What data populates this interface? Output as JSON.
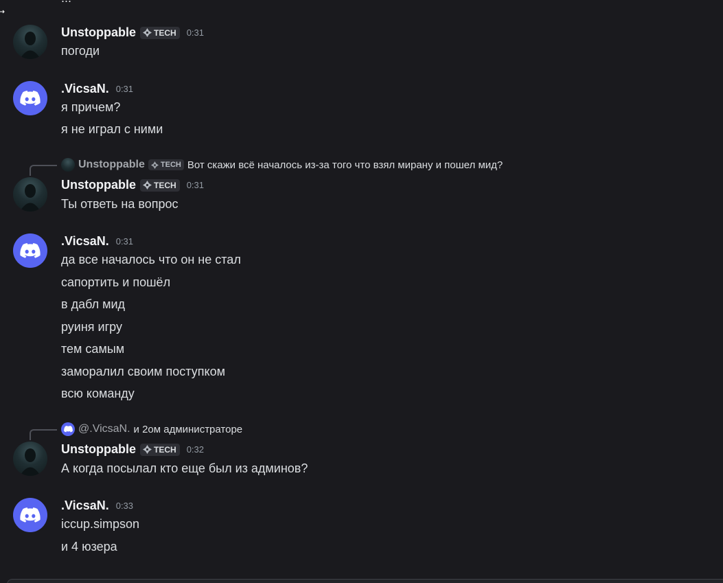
{
  "top_cutoff_text": "...",
  "messages": [
    {
      "user": "Unstoppable",
      "tag": "TECH",
      "time": "0:31",
      "lines": [
        "погоди"
      ]
    },
    {
      "user": ".VicsaN.",
      "time": "0:31",
      "lines": [
        "я причем?",
        "я не играл с ними"
      ]
    },
    {
      "reply": {
        "user": "Unstoppable",
        "tag": "TECH",
        "text": "Вот скажи всё началось из-за того что взял мирану и пошел мид?"
      },
      "user": "Unstoppable",
      "tag": "TECH",
      "time": "0:31",
      "lines": [
        "Ты ответь на вопрос"
      ]
    },
    {
      "user": ".VicsaN.",
      "time": "0:31",
      "lines": [
        "да все началось что он не стал",
        "сапортить и пошёл",
        "в дабл мид",
        "руиня игру",
        "тем самым",
        "заморалил своим поступком",
        "всю команду"
      ]
    },
    {
      "reply": {
        "user": "@.VicsaN.",
        "text": "и 2ом администраторе"
      },
      "user": "Unstoppable",
      "tag": "TECH",
      "time": "0:32",
      "lines": [
        "А когда посылал кто еще был из админов?"
      ]
    },
    {
      "user": ".VicsaN.",
      "time": "0:33",
      "lines": [
        "iccup.simpson",
        "и 4  юзера"
      ]
    }
  ],
  "colors": {
    "background": "#1a1a1e",
    "discord_blurple": "#5865f2"
  },
  "icons": {
    "tag": "diamond-tag-icon",
    "default_avatar": "discord-logo-icon"
  }
}
